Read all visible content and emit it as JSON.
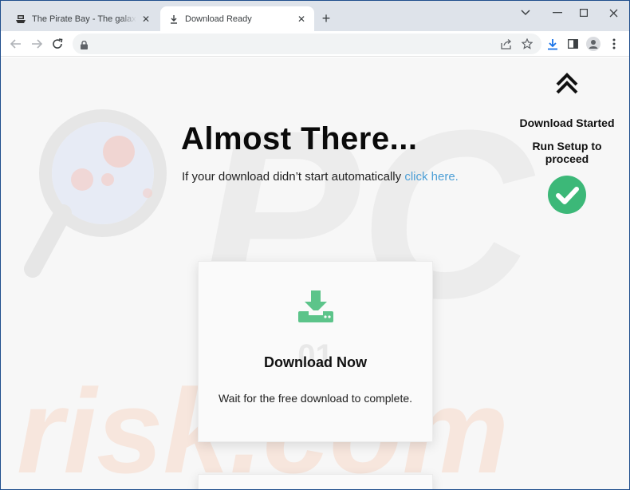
{
  "browser": {
    "tabs": [
      {
        "title": "The Pirate Bay - The galaxy's most resilient BitTorrent site",
        "active": false,
        "favicon": "ship-icon"
      },
      {
        "title": "Download Ready",
        "active": true,
        "favicon": "download-icon"
      }
    ],
    "address": {
      "value": "",
      "placeholder": ""
    },
    "colors": {
      "tabstrip": "#dee3ea",
      "toolbar": "#ffffff",
      "accent": "#1a73e8"
    }
  },
  "page": {
    "headline": "Almost There...",
    "subline_text": "If your download didn’t start automatically",
    "subline_link": "click here.",
    "side": {
      "started": "Download Started",
      "run_setup": "Run Setup to proceed"
    },
    "card": {
      "number": "01",
      "title": "Download Now",
      "text": "Wait for the free download to complete."
    },
    "colors": {
      "link": "#4d9fd6",
      "green": "#5cc48a",
      "check": "#3cb878"
    },
    "watermark": "PC risk.com"
  }
}
